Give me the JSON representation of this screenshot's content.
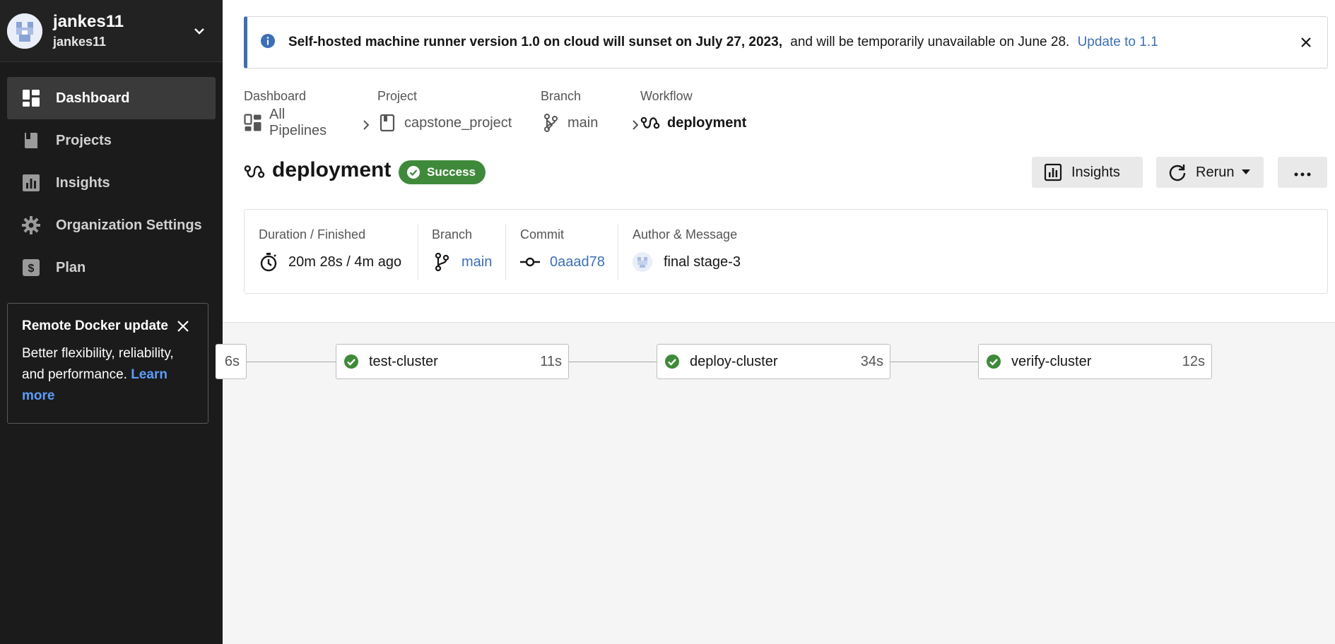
{
  "user": {
    "name": "jankes11",
    "org": "jankes11"
  },
  "nav": [
    {
      "label": "Dashboard",
      "icon": "dashboard-icon",
      "active": true
    },
    {
      "label": "Projects",
      "icon": "projects-icon"
    },
    {
      "label": "Insights",
      "icon": "insights-icon"
    },
    {
      "label": "Organization Settings",
      "icon": "gear-icon"
    },
    {
      "label": "Plan",
      "icon": "dollar-icon"
    }
  ],
  "promo": {
    "title": "Remote Docker update",
    "body": "Better flexibility, reliability, and performance.",
    "link": "Learn more"
  },
  "banner": {
    "bold": "Self-hosted machine runner version 1.0 on cloud will sunset on July 27, 2023,",
    "normal": "and will be temporarily unavailable on June 28.",
    "link": "Update to 1.1"
  },
  "breadcrumb": [
    {
      "label": "Dashboard",
      "value": "All Pipelines",
      "icon": "dashboard-icon"
    },
    {
      "label": "Project",
      "value": "capstone_project",
      "icon": "project-icon"
    },
    {
      "label": "Branch",
      "value": "main",
      "icon": "branch-icon"
    },
    {
      "label": "Workflow",
      "value": "deployment",
      "icon": "workflow-icon"
    }
  ],
  "workflow": {
    "title": "deployment",
    "status": "Success"
  },
  "actions": {
    "insights": "Insights",
    "rerun": "Rerun"
  },
  "details": {
    "duration": {
      "label": "Duration / Finished",
      "value": "20m 28s / 4m ago"
    },
    "branch": {
      "label": "Branch",
      "value": "main"
    },
    "commit": {
      "label": "Commit",
      "value": "0aaad78"
    },
    "author": {
      "label": "Author & Message",
      "value": "final stage-3"
    }
  },
  "jobs": [
    {
      "name": "",
      "duration": "6s"
    },
    {
      "name": "test-cluster",
      "duration": "11s"
    },
    {
      "name": "deploy-cluster",
      "duration": "34s"
    },
    {
      "name": "verify-cluster",
      "duration": "12s"
    }
  ],
  "colors": {
    "success": "#3f8a3a",
    "link": "#3d6fb5",
    "sidebar": "#1b1b1b"
  }
}
